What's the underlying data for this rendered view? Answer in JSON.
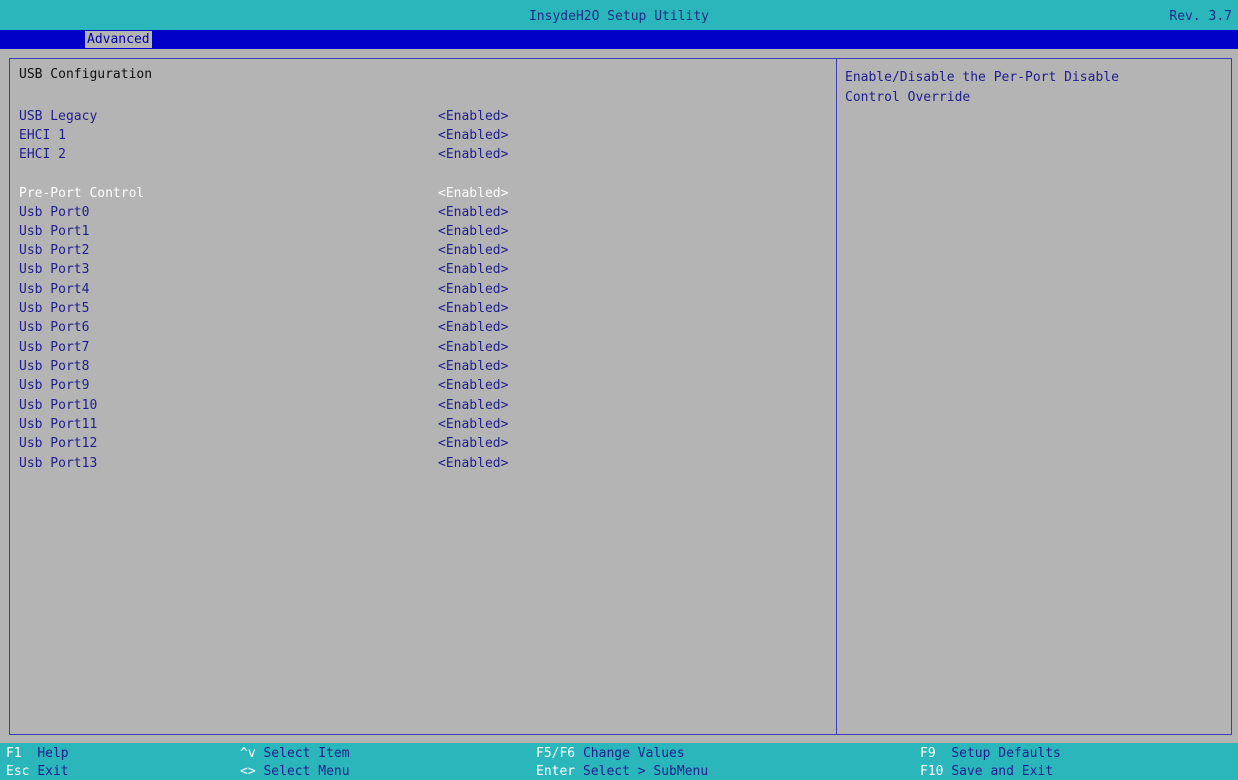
{
  "header": {
    "title": "InsydeH2O Setup Utility",
    "revision": "Rev. 3.7",
    "tabs": [
      {
        "label": "Advanced"
      }
    ]
  },
  "main": {
    "heading": "USB Configuration",
    "items": [
      {
        "label": "USB Legacy",
        "value": "<Enabled>"
      },
      {
        "label": "EHCI 1",
        "value": "<Enabled>"
      },
      {
        "label": "EHCI 2",
        "value": "<Enabled>"
      },
      {
        "label": "Pre-Port Control",
        "value": "<Enabled>",
        "selected": true
      },
      {
        "label": "Usb Port0",
        "value": "<Enabled>"
      },
      {
        "label": "Usb Port1",
        "value": "<Enabled>"
      },
      {
        "label": "Usb Port2",
        "value": "<Enabled>"
      },
      {
        "label": "Usb Port3",
        "value": "<Enabled>"
      },
      {
        "label": "Usb Port4",
        "value": "<Enabled>"
      },
      {
        "label": "Usb Port5",
        "value": "<Enabled>"
      },
      {
        "label": "Usb Port6",
        "value": "<Enabled>"
      },
      {
        "label": "Usb Port7",
        "value": "<Enabled>"
      },
      {
        "label": "Usb Port8",
        "value": "<Enabled>"
      },
      {
        "label": "Usb Port9",
        "value": "<Enabled>"
      },
      {
        "label": "Usb Port10",
        "value": "<Enabled>"
      },
      {
        "label": "Usb Port11",
        "value": "<Enabled>"
      },
      {
        "label": "Usb Port12",
        "value": "<Enabled>"
      },
      {
        "label": "Usb Port13",
        "value": "<Enabled>"
      }
    ]
  },
  "help": {
    "text": "Enable/Disable the Per-Port Disable\nControl Override"
  },
  "footer": {
    "keys": [
      {
        "key": "F1",
        "desc": "Help"
      },
      {
        "key": "Esc",
        "desc": "Exit"
      },
      {
        "key": "^v",
        "desc": "Select Item"
      },
      {
        "key": "<>",
        "desc": "Select Menu"
      },
      {
        "key": "F5/F6",
        "desc": "Change Values"
      },
      {
        "key": "Enter",
        "desc": "Select > SubMenu"
      },
      {
        "key": "F9",
        "desc": "Setup Defaults"
      },
      {
        "key": "F10",
        "desc": "Save and Exit"
      }
    ]
  },
  "colors": {
    "background": "#b4b4b4",
    "title_bar": "#2bb6bb",
    "tab_bar": "#0000c8",
    "item_text": "#1e1e8c",
    "selected_text": "#ffffff"
  }
}
